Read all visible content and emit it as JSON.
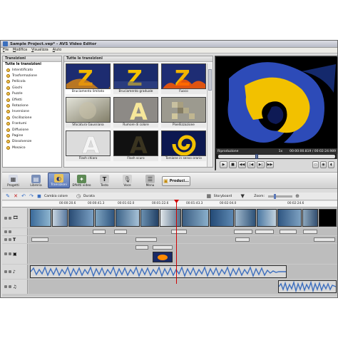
{
  "window": {
    "title": "Sample Project.vep* - AVS Video Editor",
    "menu": [
      "File",
      "Modifica",
      "Visualizza",
      "Aiuto"
    ]
  },
  "left_panel": {
    "header": "Transizioni",
    "root": "Tutte le transizioni",
    "items": [
      "Interstificato",
      "Trasformazione",
      "Pellicola",
      "Giochi",
      "Puzzle",
      "Effetti",
      "Rotazione",
      "Inversione",
      "Oscillazione",
      "Frantumi",
      "Diffusione",
      "Pagine",
      "Dissolvenze",
      "Mosaico"
    ]
  },
  "center_panel": {
    "header": "Tutte le transizioni",
    "thumbnails": [
      {
        "caption": "Bruciamento limitato"
      },
      {
        "caption": "Bruciamento graduale"
      },
      {
        "caption": "Fuoco"
      },
      {
        "caption": "Sfocatura Gaussiana"
      },
      {
        "caption": "Rumore di colore"
      },
      {
        "caption": "Pixellizzazione"
      },
      {
        "caption": "Flash chiaro"
      },
      {
        "caption": "Flash scuro"
      },
      {
        "caption": "Torsione in senso orario"
      }
    ]
  },
  "preview": {
    "status_label": "Riproduzione",
    "speed": "1x",
    "time": "00:00:00.819 / 00:02:24.989"
  },
  "toolbar": {
    "buttons": [
      {
        "label": "Progetti",
        "icon": "projects-icon"
      },
      {
        "label": "Libreria",
        "icon": "library-icon"
      },
      {
        "label": "Transizioni",
        "icon": "transitions-icon"
      },
      {
        "label": "Effetti video",
        "icon": "video-effects-icon"
      },
      {
        "label": "Testo",
        "icon": "text-icon"
      },
      {
        "label": "Voce",
        "icon": "voice-icon"
      },
      {
        "label": "Menu",
        "icon": "menu-icon"
      }
    ],
    "produce_label": "Produci..."
  },
  "timeline_bar": {
    "change_color": "Cambia colore",
    "duration": "Durata",
    "storyboard": "Storyboard",
    "zoom": "Zoom:"
  },
  "ruler": [
    "00:00:20.6",
    "00:00:41.3",
    "00:01:02.0",
    "00:01:22.6",
    "00:01:43.3",
    "00:02:04.0",
    "00:02:24.6"
  ],
  "colors": {
    "accent": "#5b78b8",
    "text_track": "#e7e7e7",
    "audio": "#3d6fbf"
  }
}
